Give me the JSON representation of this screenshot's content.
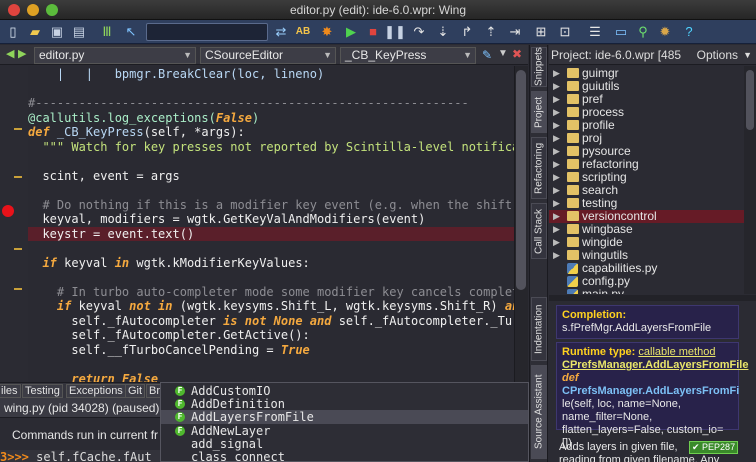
{
  "window": {
    "title": "editor.py (edit): ide-6.0.wpr: Wing"
  },
  "toolbar": {
    "search_value": "",
    "icons": [
      "new-file",
      "open-folder",
      "save",
      "save-all",
      "columns",
      "pointer",
      "search-box",
      "replace",
      "ab-diff",
      "debug-bug",
      "run",
      "stop",
      "pause",
      "step-over",
      "step-into",
      "step-out",
      "step-return",
      "indent-left",
      "indent-right",
      "config",
      "layout",
      "monitor",
      "search",
      "bug-inspect",
      "help"
    ]
  },
  "editor": {
    "file_combo": "editor.py",
    "class_combo": "CSourceEditor",
    "method_combo": "_CB_KeyPress",
    "lines": [
      [
        {
          "t": "    |   |   bpmgr.BreakClear(loc, lineno)",
          "c": "fn"
        }
      ],
      [
        {
          "t": "",
          "c": ""
        }
      ],
      [
        {
          "t": "#------------------------------------------------------------",
          "c": "cm"
        }
      ],
      [
        {
          "t": "@callutils.log_exceptions(",
          "c": "dec"
        },
        {
          "t": "False",
          "c": "kw"
        },
        {
          "t": ")",
          "c": "dec"
        }
      ],
      [
        {
          "t": "def ",
          "c": "kw"
        },
        {
          "t": "_CB_KeyPress",
          "c": "fn"
        },
        {
          "t": "(self, *args):",
          "c": "op"
        }
      ],
      [
        {
          "t": "  \"\"\" Watch for key presses not reported by Scintilla-level notifica",
          "c": "str"
        }
      ],
      [
        {
          "t": "",
          "c": ""
        }
      ],
      [
        {
          "t": "  scint, event = args",
          "c": "op"
        }
      ],
      [
        {
          "t": "",
          "c": ""
        }
      ],
      [
        {
          "t": "  # Do nothing if this is a modifier key event (e.g. when the shift",
          "c": "cm"
        }
      ],
      [
        {
          "t": "  keyval, modifiers = wgtk.GetKeyValAndModifiers(event)",
          "c": "op"
        }
      ],
      [
        {
          "t": "  keystr = event.text()",
          "c": "op"
        }
      ],
      [
        {
          "t": "",
          "c": ""
        }
      ],
      [
        {
          "t": "  ",
          "c": "op"
        },
        {
          "t": "if",
          "c": "kw"
        },
        {
          "t": " keyval ",
          "c": "op"
        },
        {
          "t": "in",
          "c": "kw"
        },
        {
          "t": " wgtk.kModifierKeyValues:",
          "c": "op"
        }
      ],
      [
        {
          "t": "",
          "c": ""
        }
      ],
      [
        {
          "t": "    # In turbo auto-completer mode some modifier key cancels complet",
          "c": "cm"
        }
      ],
      [
        {
          "t": "    ",
          "c": "op"
        },
        {
          "t": "if",
          "c": "kw"
        },
        {
          "t": " keyval ",
          "c": "op"
        },
        {
          "t": "not in",
          "c": "kw"
        },
        {
          "t": " (wgtk.keysyms.Shift_L, wgtk.keysyms.Shift_R) ",
          "c": "op"
        },
        {
          "t": "an",
          "c": "kw"
        }
      ],
      [
        {
          "t": "      self._fAutocompleter ",
          "c": "op"
        },
        {
          "t": "is not",
          "c": "kw"
        },
        {
          "t": " None ",
          "c": "kw"
        },
        {
          "t": "and",
          "c": "kw"
        },
        {
          "t": " self._fAutocompleter._Tu",
          "c": "op"
        }
      ],
      [
        {
          "t": "      self._fAutocompleter.GetActive():",
          "c": "op"
        }
      ],
      [
        {
          "t": "      self.__fTurboCancelPending = ",
          "c": "op"
        },
        {
          "t": "True",
          "c": "kw"
        }
      ],
      [
        {
          "t": "",
          "c": ""
        }
      ],
      [
        {
          "t": "      ",
          "c": "op"
        },
        {
          "t": "return",
          "c": "kw"
        },
        {
          "t": " ",
          "c": "op"
        },
        {
          "t": "False",
          "c": "kw"
        }
      ]
    ],
    "breakpoint_line": 11
  },
  "side_tabs": [
    "Snippets",
    "Project",
    "Refactoring",
    "Call Stack",
    "Indentation",
    "Source Assistant"
  ],
  "project": {
    "title": "Project: ide-6.0.wpr [485",
    "options_label": "Options",
    "items": [
      {
        "label": "guimgr",
        "type": "folder"
      },
      {
        "label": "guiutils",
        "type": "folder"
      },
      {
        "label": "pref",
        "type": "folder"
      },
      {
        "label": "process",
        "type": "folder"
      },
      {
        "label": "profile",
        "type": "folder"
      },
      {
        "label": "proj",
        "type": "folder"
      },
      {
        "label": "pysource",
        "type": "folder"
      },
      {
        "label": "refactoring",
        "type": "folder"
      },
      {
        "label": "scripting",
        "type": "folder"
      },
      {
        "label": "search",
        "type": "folder"
      },
      {
        "label": "testing",
        "type": "folder"
      },
      {
        "label": "versioncontrol",
        "type": "folder",
        "selected": true
      },
      {
        "label": "wingbase",
        "type": "folder"
      },
      {
        "label": "wingide",
        "type": "folder"
      },
      {
        "label": "wingutils",
        "type": "folder"
      },
      {
        "label": "capabilities.py",
        "type": "py"
      },
      {
        "label": "config.py",
        "type": "py"
      },
      {
        "label": "main.py",
        "type": "py"
      }
    ]
  },
  "assistant": {
    "completion_label": "Completion:",
    "completion_value": "s.fPrefMgr.AddLayersFromFile",
    "runtime_label": "Runtime type:",
    "runtime_type": "callable method",
    "runtime_class": "CPrefsManager.AddLayersFromFile",
    "def_kw": "def",
    "def_name": "CPrefsManager.AddLayersFromFi",
    "def_sig": "le(self, loc, name=None, name_filter=None, flatten_layers=False, custom_io=[])",
    "desc1": "Adds layers in given file,",
    "desc2": "reading from given filename. Any",
    "pep": "PEP287"
  },
  "bottom": {
    "tabs": [
      "iles",
      "Testing",
      "Exceptions",
      "Git",
      "Br"
    ],
    "process": "wing.py (pid 34028) (paused)",
    "commands_text": "Commands run in current fr",
    "prompt": "3>>>",
    "prompt_text": " self.fCache.fAut"
  },
  "autocomplete": [
    {
      "label": "AddCustomIO",
      "icon": "F"
    },
    {
      "label": "AddDefinition",
      "icon": "F"
    },
    {
      "label": "AddLayersFromFile",
      "icon": "F",
      "selected": true
    },
    {
      "label": "AddNewLayer",
      "icon": "F"
    },
    {
      "label": "add_signal",
      "icon": ""
    },
    {
      "label": "class_connect",
      "icon": ""
    }
  ]
}
